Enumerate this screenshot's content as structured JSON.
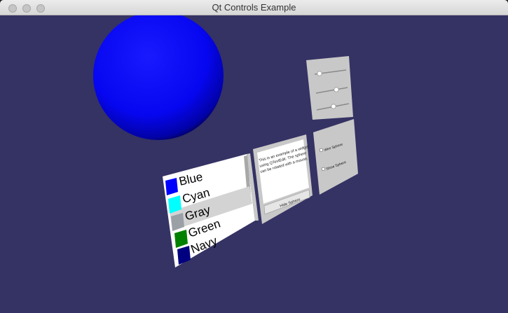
{
  "window": {
    "title": "Qt Controls Example"
  },
  "colors": {
    "scene_background": "#353264",
    "sphere": "#0000ff"
  },
  "list": {
    "items": [
      {
        "label": "Blue",
        "color": "#0000ff",
        "selected": false
      },
      {
        "label": "Cyan",
        "color": "#00ffff",
        "selected": false
      },
      {
        "label": "Gray",
        "color": "#9aa0a6",
        "selected": true
      },
      {
        "label": "Green",
        "color": "#008000",
        "selected": false
      },
      {
        "label": "Navy",
        "color": "#000080",
        "selected": false
      }
    ]
  },
  "text_panel": {
    "text_lines": [
      "This is an example of a widget",
      "using QTextEdit. The sphere",
      "can be rotated with a mouse."
    ],
    "button_label": "Hide Sphere"
  },
  "sliders": {
    "values": [
      0.15,
      0.6,
      0.5
    ]
  },
  "checkboxes": {
    "items": [
      {
        "label": "Wire Sphere",
        "checked": false
      },
      {
        "label": "Show Sphere",
        "checked": false
      }
    ]
  }
}
